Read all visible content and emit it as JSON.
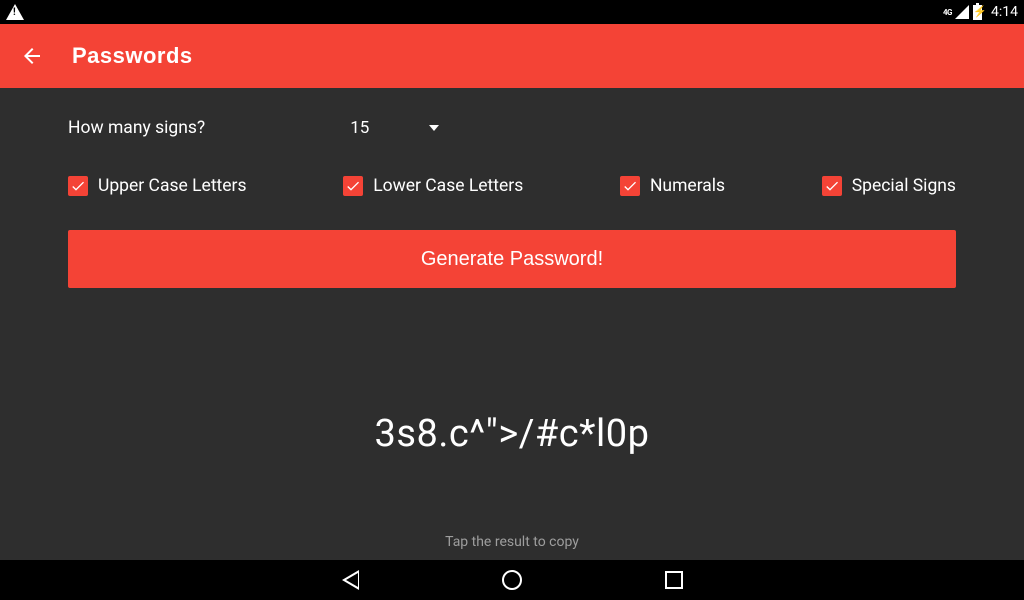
{
  "status": {
    "network": "4G",
    "time": "4:14"
  },
  "appbar": {
    "title": "Passwords"
  },
  "form": {
    "signs_label": "How many signs?",
    "signs_value": "15",
    "options": {
      "upper": {
        "label": "Upper Case Letters",
        "checked": true
      },
      "lower": {
        "label": "Lower Case Letters",
        "checked": true
      },
      "numerals": {
        "label": "Numerals",
        "checked": true
      },
      "special": {
        "label": "Special Signs",
        "checked": true
      }
    },
    "generate_label": "Generate Password!"
  },
  "result": {
    "value": "3s8.c^\">/#c*l0p",
    "hint": "Tap the result to copy"
  }
}
